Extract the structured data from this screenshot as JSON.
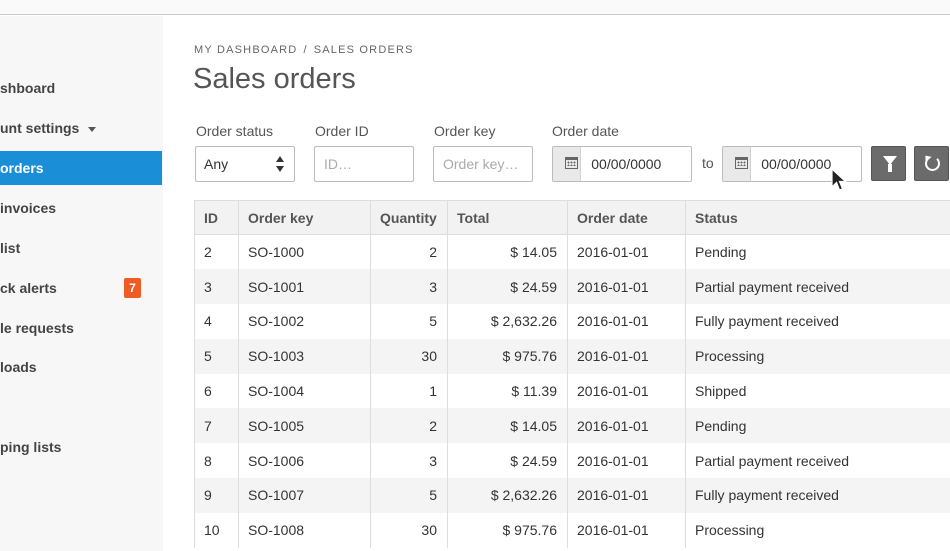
{
  "sidebar": {
    "items": [
      {
        "label": "shboard",
        "active": false
      },
      {
        "label": "unt settings",
        "active": false,
        "has_caret": true
      },
      {
        "label": "orders",
        "active": true
      },
      {
        "label": "invoices",
        "active": false
      },
      {
        "label": "list",
        "active": false
      },
      {
        "label": "ck alerts",
        "active": false,
        "badge": "7"
      },
      {
        "label": "le requests",
        "active": false
      },
      {
        "label": "loads",
        "active": false
      },
      {
        "label": "ping lists",
        "active": false
      }
    ]
  },
  "breadcrumb": {
    "root": "MY DASHBOARD",
    "separator": "/",
    "current": "SALES ORDERS"
  },
  "page_title": "Sales orders",
  "filters": {
    "order_status": {
      "label": "Order status",
      "value": "Any"
    },
    "order_id": {
      "label": "Order ID",
      "placeholder": "ID…"
    },
    "order_key": {
      "label": "Order key",
      "placeholder": "Order key…"
    },
    "order_date": {
      "label": "Order date",
      "from_value": "00/00/0000",
      "to_label": "to",
      "to_value": "00/00/0000"
    }
  },
  "icons": {
    "filter": "filter-icon",
    "reset": "reset-icon",
    "calendar": "calendar-icon"
  },
  "colors": {
    "accent": "#1a8fd7",
    "badge": "#f05a24",
    "button": "#6b6b6b"
  },
  "table": {
    "columns": [
      "ID",
      "Order key",
      "Quantity",
      "Total",
      "Order date",
      "Status"
    ],
    "rows": [
      [
        "2",
        "SO-1000",
        "2",
        "$ 14.05",
        "2016-01-01",
        "Pending"
      ],
      [
        "3",
        "SO-1001",
        "3",
        "$ 24.59",
        "2016-01-01",
        "Partial payment received"
      ],
      [
        "4",
        "SO-1002",
        "5",
        "$ 2,632.26",
        "2016-01-01",
        "Fully payment received"
      ],
      [
        "5",
        "SO-1003",
        "30",
        "$ 975.76",
        "2016-01-01",
        "Processing"
      ],
      [
        "6",
        "SO-1004",
        "1",
        "$ 11.39",
        "2016-01-01",
        "Shipped"
      ],
      [
        "7",
        "SO-1005",
        "2",
        "$ 14.05",
        "2016-01-01",
        "Pending"
      ],
      [
        "8",
        "SO-1006",
        "3",
        "$ 24.59",
        "2016-01-01",
        "Partial payment received"
      ],
      [
        "9",
        "SO-1007",
        "5",
        "$ 2,632.26",
        "2016-01-01",
        "Fully payment received"
      ],
      [
        "10",
        "SO-1008",
        "30",
        "$ 975.76",
        "2016-01-01",
        "Processing"
      ]
    ]
  }
}
